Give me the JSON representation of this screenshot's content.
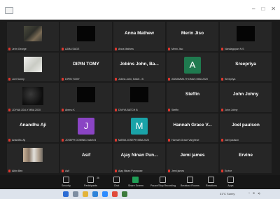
{
  "tiles": [
    {
      "display": "photo",
      "label": "Jerin George"
    },
    {
      "display": "black",
      "label": "AJMA SAGE"
    },
    {
      "name": "Anna Mathew",
      "label": "Anna Mathew"
    },
    {
      "name": "Merin Jiso",
      "label": "Merin Jiso"
    },
    {
      "display": "black",
      "label": "Nandagopan N S"
    },
    {
      "display": "light",
      "label": "Joel Sunny"
    },
    {
      "name": "DIPIN TOMY",
      "label": "DIPIN TOMY"
    },
    {
      "name": "Jobins John, Ba...",
      "label": "Jobins John, Batch - B"
    },
    {
      "avatar": "A",
      "avatar_color": "#1f7a4f",
      "label": "ANNAMMA THOMAS MBA 2020"
    },
    {
      "name": "Sreepriya",
      "label": "Sreepriya"
    },
    {
      "display": "dark",
      "label": "JOYNA JOLLY MBA 2020"
    },
    {
      "display": "black",
      "label": "Abenu K"
    },
    {
      "display": "black",
      "label": "DIVIYA BATCH B"
    },
    {
      "name": "Steffin",
      "label": "Steffin"
    },
    {
      "name": "John Johny",
      "label": "John Johny"
    },
    {
      "name": "Anandhu Aji",
      "label": "Anandhu Aji"
    },
    {
      "avatar": "J",
      "avatar_color": "#8a44c4",
      "label": "JOSEPH DOMINIC batch B"
    },
    {
      "avatar": "M",
      "avatar_color": "#1aa3a8",
      "label": "MARIA JOSEPH MBA 2020"
    },
    {
      "name": "Hannah Grace V...",
      "label": "Hannah Grace Varghese"
    },
    {
      "name": "Joel paulson",
      "label": "Joel paulson"
    },
    {
      "display": "people",
      "label": "Albin Ben"
    },
    {
      "name": "Asif",
      "label": "Asif"
    },
    {
      "name": "Ajay Ninan Pun...",
      "label": "Ajay Ninan Punnoose"
    },
    {
      "name": "Jemi james",
      "label": "Jemi james"
    },
    {
      "name": "Ervine",
      "label": "Ervine"
    }
  ],
  "toolbar": {
    "security": "Security",
    "participants": "Participants",
    "participants_count": "36",
    "chat": "Chat",
    "share_screen": "Share Screen",
    "pause_recording": "Pause/Stop Recording",
    "breakout_rooms": "Breakout Rooms",
    "reactions": "Reactions",
    "apps": "Apps"
  },
  "taskbar": {
    "weather": "31°C Sunny",
    "tray_icons": [
      "chevron-up-icon",
      "wifi-icon",
      "speaker-icon"
    ]
  },
  "colors": {
    "stage_bg": "#1b1b1b",
    "tile_bg": "#262626",
    "share_green": "#1f9d55",
    "mic_red": "#e0382e"
  }
}
